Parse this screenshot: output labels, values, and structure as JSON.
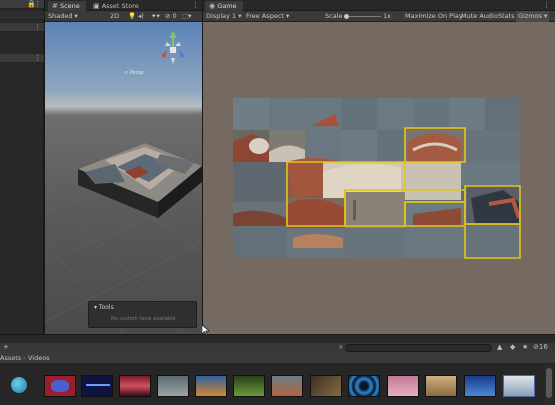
{
  "scene_tabs": [
    {
      "label": "Scene",
      "icon": "grid-icon",
      "active": true
    },
    {
      "label": "Asset Store",
      "icon": "bag-icon",
      "active": false
    }
  ],
  "game_tabs": [
    {
      "label": "Game",
      "icon": "gamepad-icon",
      "active": true
    }
  ],
  "scene_toolbar": {
    "shading_mode": "Shaded",
    "mode_2d": "2D"
  },
  "scene_view": {
    "gizmo_label": "< Persp"
  },
  "tools_overlay": {
    "title": "Tools",
    "message": "No custom tools available"
  },
  "game_toolbar": {
    "display": "Display 1",
    "aspect": "Free Aspect",
    "scale_label": "Scale",
    "scale_value": "1x",
    "maximize_on_play": "Maximize On Play",
    "mute_audio": "Mute Audio",
    "stats": "Stats",
    "gizmos": "Gizmos"
  },
  "project": {
    "breadcrumb": [
      "Assets",
      "Videos"
    ],
    "search_placeholder": "",
    "hidden_count": "16",
    "thumb_labels": [
      "",
      "",
      "",
      "",
      "",
      "",
      "",
      "",
      "",
      "",
      "",
      "",
      "",
      "",
      ""
    ]
  },
  "colors": {
    "selection_outline": "#e3c619",
    "editor_bg": "#282828",
    "game_bg": "#746a62"
  }
}
